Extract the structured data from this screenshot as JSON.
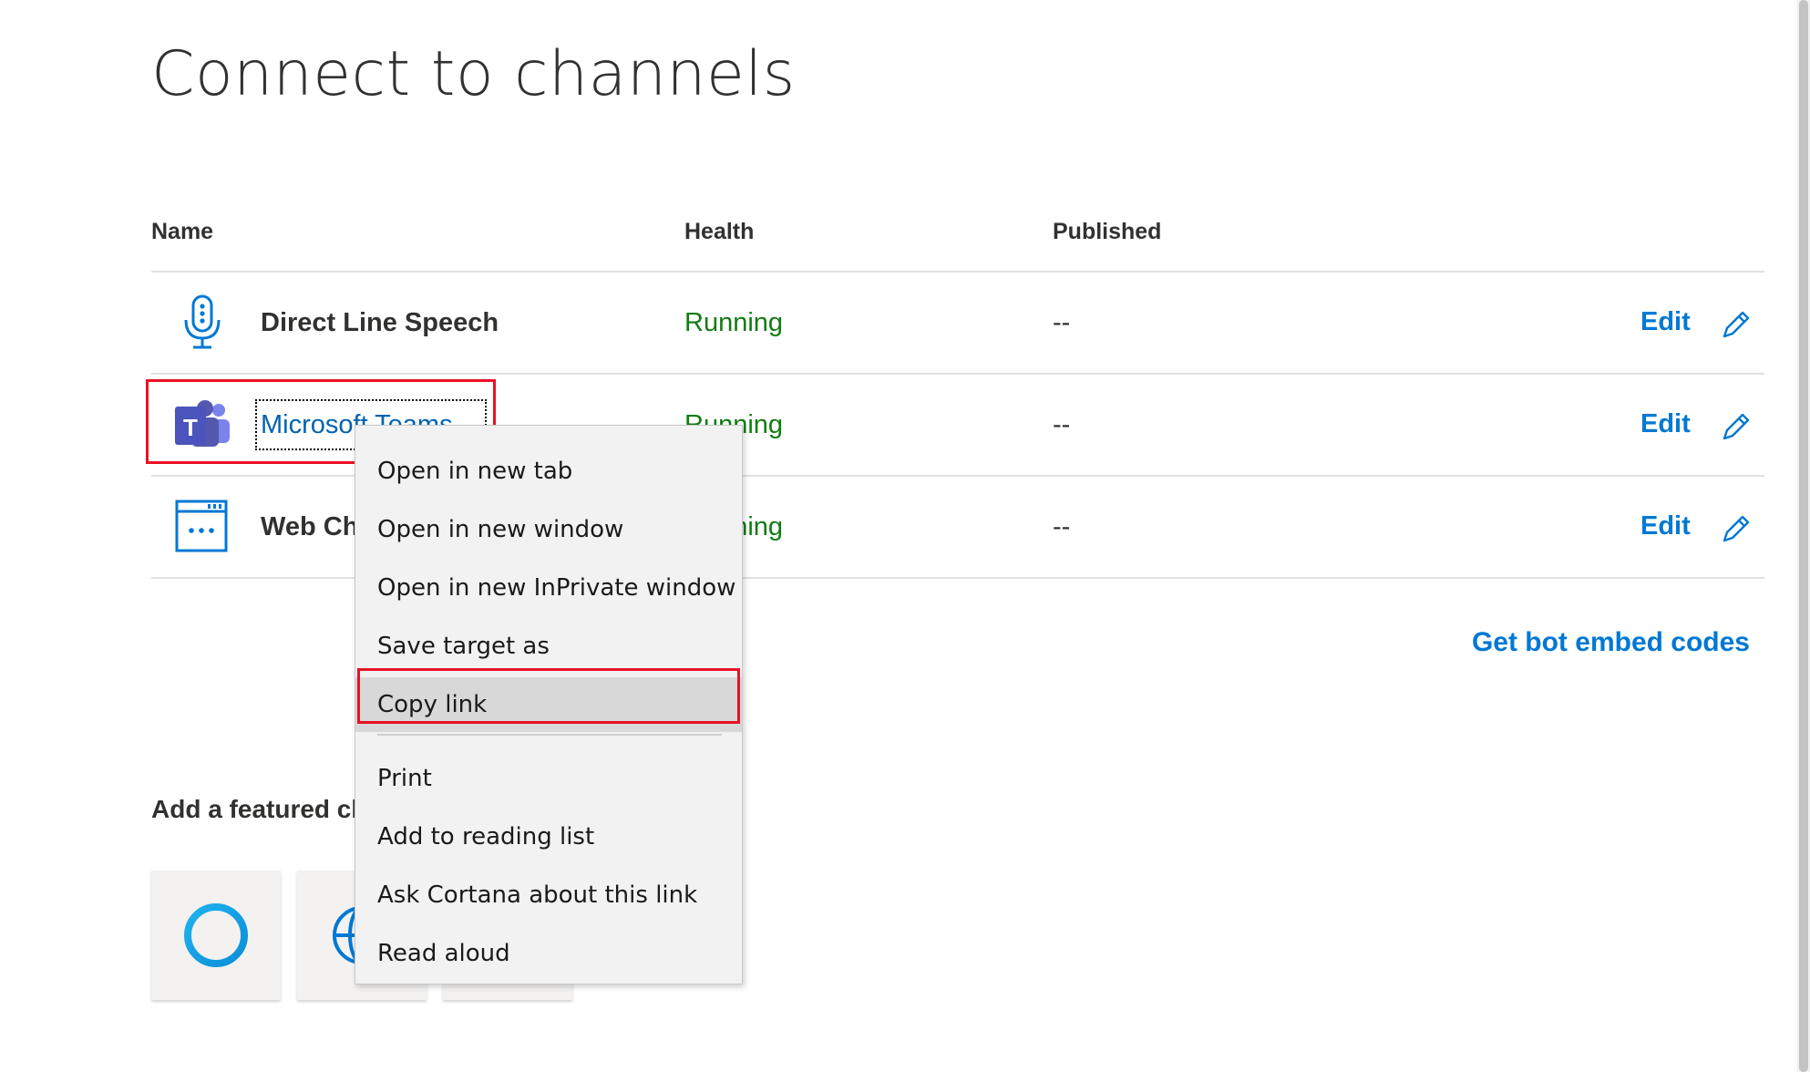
{
  "page": {
    "title": "Connect to channels"
  },
  "table": {
    "headers": {
      "name": "Name",
      "health": "Health",
      "published": "Published"
    },
    "rows": [
      {
        "name": "Direct Line Speech",
        "health": "Running",
        "published": "--",
        "action": "Edit",
        "icon": "microphone-icon"
      },
      {
        "name": "Microsoft Teams",
        "health": "Running",
        "published": "--",
        "action": "Edit",
        "icon": "teams-icon"
      },
      {
        "name": "Web Chat",
        "health": "Running",
        "published": "--",
        "action": "Edit",
        "icon": "webchat-icon"
      }
    ]
  },
  "links": {
    "embed_codes": "Get bot embed codes"
  },
  "featured": {
    "heading": "Add a featured channel",
    "tiles": [
      "cortana-icon",
      "globe-icon",
      "channel-icon"
    ]
  },
  "context_menu": {
    "items": [
      "Open in new tab",
      "Open in new window",
      "Open in new InPrivate window",
      "Save target as",
      "Copy link",
      "Print",
      "Add to reading list",
      "Ask Cortana about this link",
      "Read aloud"
    ],
    "highlighted": "Copy link"
  },
  "colors": {
    "accent": "#0078d4",
    "running": "#107c10",
    "highlight_border": "#e81123",
    "teams": "#5558af"
  }
}
